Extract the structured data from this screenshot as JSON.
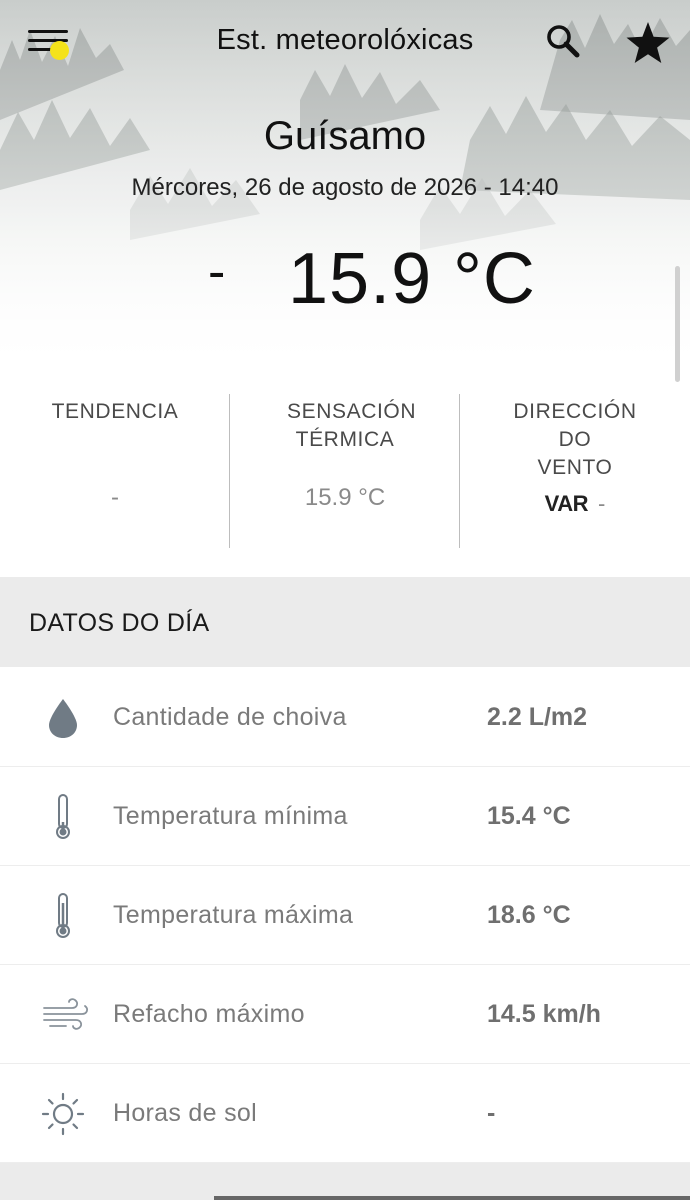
{
  "header": {
    "title": "Est. meteorolóxicas",
    "icons": {
      "menu": "menu-icon",
      "notification": "notification-dot",
      "search": "search-icon",
      "favorite": "star-icon"
    },
    "notification_color": "#f4e21a"
  },
  "station": {
    "name": "Guísamo",
    "datetime": "Mércores, 26 de agosto de 2026 - 14:40",
    "temp_prefix": "-",
    "temperature": "15.9 °C"
  },
  "summary": {
    "tendencia": {
      "label": "TENDENCIA",
      "value": "-"
    },
    "sensacion": {
      "label": "SENSACIÓN TÉRMICA",
      "value": "15.9 °C"
    },
    "vento": {
      "label": "DIRECCIÓN DO VENTO",
      "direction": "VAR",
      "value": "-"
    }
  },
  "daily": {
    "title": "DATOS DO DÍA",
    "rows": [
      {
        "icon": "raindrop-icon",
        "label": "Cantidade de choiva",
        "value": "2.2 L/m2"
      },
      {
        "icon": "thermometer-min-icon",
        "label": "Temperatura mínima",
        "value": "15.4 °C"
      },
      {
        "icon": "thermometer-max-icon",
        "label": "Temperatura máxima",
        "value": "18.6 °C"
      },
      {
        "icon": "wind-icon",
        "label": "Refacho máximo",
        "value": "14.5 km/h"
      },
      {
        "icon": "sun-icon",
        "label": "Horas de sol",
        "value": "-"
      }
    ]
  }
}
